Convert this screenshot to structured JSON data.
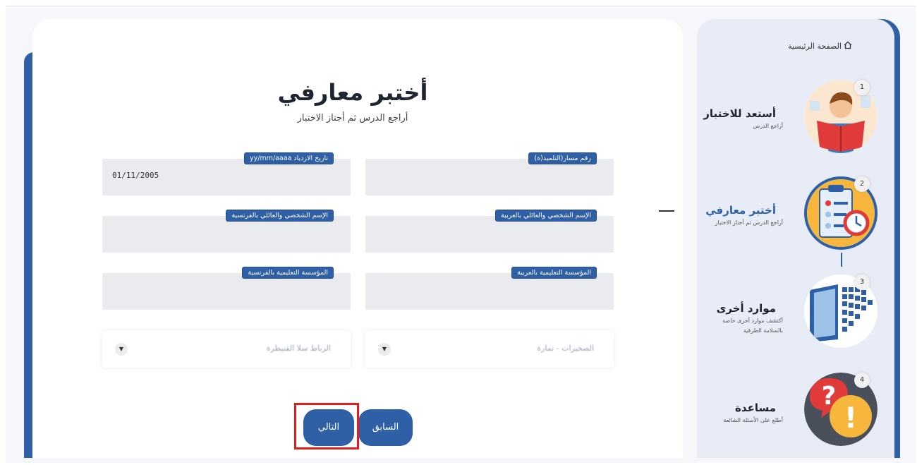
{
  "page": {
    "title": "أختبر معارفي",
    "subtitle": "أراجع الدرس ثم أجتاز الاختبار"
  },
  "form": {
    "student_id": {
      "label": "رقم مسار(التلميذ(ة)",
      "value": ""
    },
    "birth_date": {
      "label": "تاريخ الازدياد yy/mm/aaaa",
      "value": "01/11/2005"
    },
    "name_ar": {
      "label": "الإسم الشخصي والعائلي بالعربية",
      "value": ""
    },
    "name_fr": {
      "label": "الإسم الشخصي والعائلي بالفرنسية",
      "value": ""
    },
    "school_ar": {
      "label": "المؤسسة التعليمية بالعربية",
      "value": ""
    },
    "school_fr": {
      "label": "المؤسسة التعليمية بالفرنسية",
      "value": ""
    },
    "region_select": {
      "value": "الرباط سلا القنيطرة"
    },
    "province_select": {
      "value": "الصخيرات - تمارة"
    }
  },
  "buttons": {
    "prev": "السابق",
    "next": "التالي"
  },
  "sidebar": {
    "home": "الصفحة الرئيسية",
    "steps": [
      {
        "num": "1",
        "title": "أستعد للاختبار",
        "desc": "أراجع الدرس"
      },
      {
        "num": "2",
        "title": "أختبر معارفي",
        "desc": "أراجع الدرس ثم أجتاز الاختبار"
      },
      {
        "num": "3",
        "title": "موارد أخرى",
        "desc": "أكتشف موارد أخرى خاصة بالسلامة الطرقية"
      },
      {
        "num": "4",
        "title": "مساعدة",
        "desc": "أطلع على الأسئلة الشائعة"
      }
    ]
  },
  "colors": {
    "primary": "#2f5fa5",
    "highlight": "#e11d1d"
  },
  "icons": [
    "home-icon",
    "reading-student-icon",
    "checklist-clock-icon",
    "book-icon",
    "question-exclamation-icon",
    "chevron-down-icon"
  ]
}
